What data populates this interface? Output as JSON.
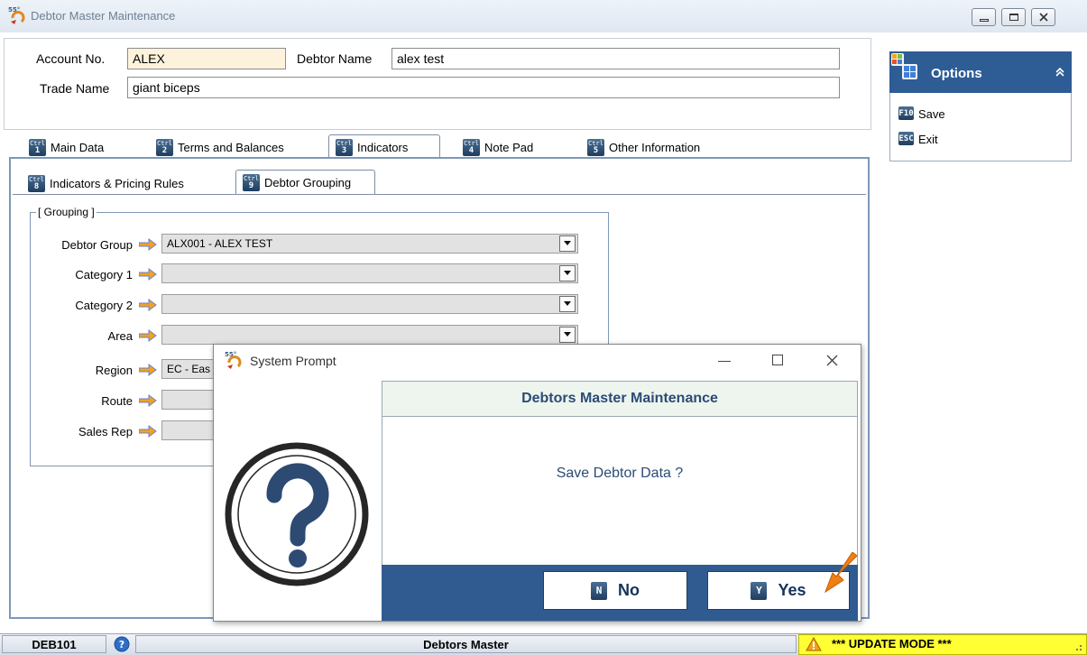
{
  "window": {
    "title": "Debtor Master Maintenance",
    "logo_text": "55°"
  },
  "header": {
    "account_label": "Account No.",
    "account_value": "ALEX",
    "debtor_name_label": "Debtor Name",
    "debtor_name_value": "alex test",
    "trade_name_label": "Trade Name",
    "trade_name_value": "giant biceps"
  },
  "main_tabs": [
    {
      "ctrl": "Ctrl",
      "num": "1",
      "label": "Main Data"
    },
    {
      "ctrl": "Ctrl",
      "num": "2",
      "label": "Terms and Balances"
    },
    {
      "ctrl": "Ctrl",
      "num": "3",
      "label": "Indicators"
    },
    {
      "ctrl": "Ctrl",
      "num": "4",
      "label": "Note Pad"
    },
    {
      "ctrl": "Ctrl",
      "num": "5",
      "label": "Other Information"
    }
  ],
  "sub_tabs": [
    {
      "ctrl": "Ctrl",
      "num": "8",
      "label": "Indicators & Pricing Rules"
    },
    {
      "ctrl": "Ctrl",
      "num": "9",
      "label": "Debtor Grouping"
    }
  ],
  "grouping": {
    "legend": "[ Grouping ]",
    "rows": [
      {
        "label": "Debtor Group",
        "value": "ALX001 - ALEX TEST"
      },
      {
        "label": "Category 1",
        "value": ""
      },
      {
        "label": "Category 2",
        "value": ""
      },
      {
        "label": "Area",
        "value": ""
      },
      {
        "label": "Region",
        "value": "EC - Eas"
      },
      {
        "label": "Route",
        "value": ""
      },
      {
        "label": "Sales Rep",
        "value": ""
      }
    ]
  },
  "options": {
    "title": "Options",
    "items": [
      {
        "key": "F10",
        "label": "Save"
      },
      {
        "key": "ESC",
        "label": "Exit"
      }
    ]
  },
  "dialog": {
    "title": "System Prompt",
    "heading": "Debtors Master Maintenance",
    "message": "Save Debtor Data ?",
    "icon": "question-icon",
    "no_key": "N",
    "no_label": "No",
    "yes_key": "Y",
    "yes_label": "Yes"
  },
  "status": {
    "code": "DEB101",
    "module": "Debtors Master",
    "mode": "*** UPDATE MODE ***"
  },
  "colors": {
    "accent": "#2f5b91",
    "account_field_bg": "#fdf3dc",
    "status_mode_bg": "#ffff33",
    "arrow": "#f0a31c",
    "callout_arrow": "#f07f14"
  }
}
